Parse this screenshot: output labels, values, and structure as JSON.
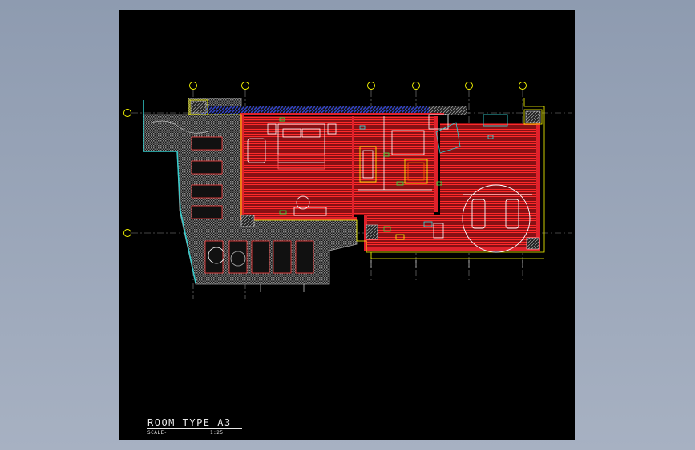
{
  "drawing": {
    "title": "ROOM TYPE A3",
    "scale_label": "SCALE-",
    "scale_value": "1:25"
  },
  "colors": {
    "background": "#000000",
    "wall_fill": "#e0212b",
    "floor_hatch": "#ff2a2a",
    "outline": "#ffff00",
    "terrace": "#8a8a8a",
    "glass": "#33cccc",
    "grid_line": "#888888",
    "grid_bubble": "#ffff00",
    "tag_green": "#22ee44",
    "tag_cyan": "#33dddd",
    "roof_blue": "#3344cc"
  },
  "icons": [
    "grid-bubble-icon",
    "bed-icon",
    "bathtub-icon",
    "sofa-icon",
    "chair-icon",
    "lounger-icon"
  ]
}
